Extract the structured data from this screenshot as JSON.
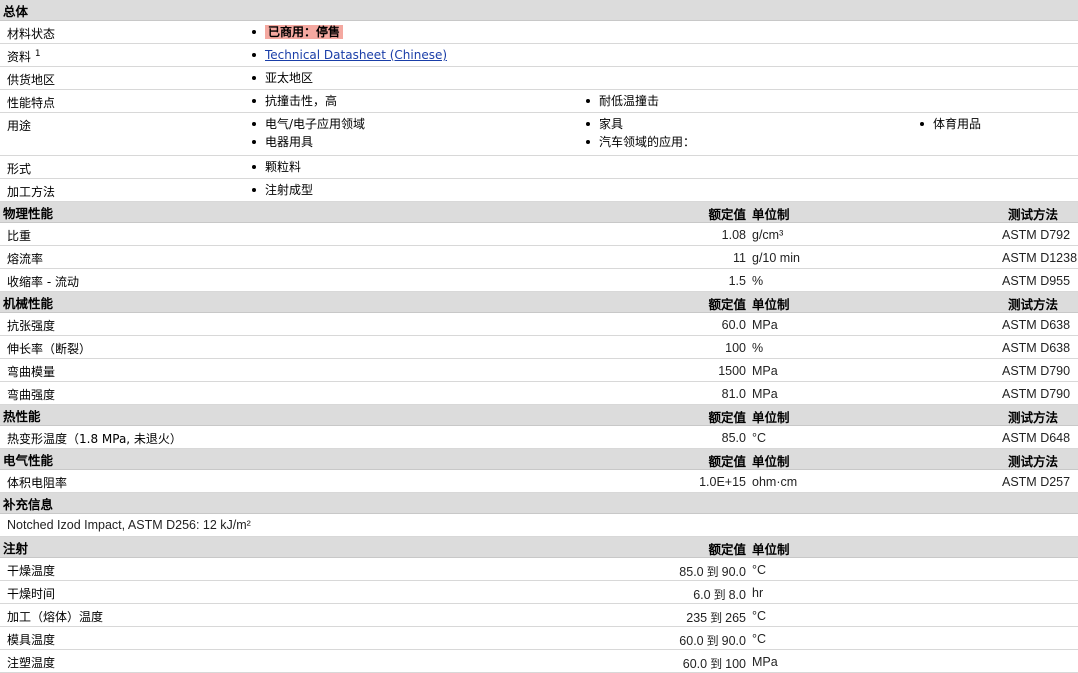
{
  "general": {
    "title": "总体",
    "status_label": "材料状态",
    "status_value": "已商用：停售",
    "docs_label": "资料",
    "docs_sup": "1",
    "docs_link": "Technical Datasheet (Chinese)",
    "region_label": "供货地区",
    "region_value": "亚太地区",
    "features_label": "性能特点",
    "features": [
      "抗撞击性，高",
      "耐低温撞击"
    ],
    "uses_label": "用途",
    "uses": [
      "电气/电子应用领域",
      "家具",
      "体育用品",
      "电器用具",
      "汽车领域的应用："
    ],
    "form_label": "形式",
    "form_value": "颗粒料",
    "process_label": "加工方法",
    "process_value": "注射成型"
  },
  "headers": {
    "nominal": "额定值",
    "unit": "单位制",
    "method": "测试方法"
  },
  "physical": {
    "title": "物理性能",
    "rows": [
      {
        "label": "比重",
        "value": "1.08",
        "unit": "g/cm³",
        "method": "ASTM D792"
      },
      {
        "label": "熔流率",
        "value": "11",
        "unit": "g/10 min",
        "method": "ASTM D1238"
      },
      {
        "label": "收缩率 - 流动",
        "value": "1.5",
        "unit": "%",
        "method": "ASTM D955"
      }
    ]
  },
  "mechanical": {
    "title": "机械性能",
    "rows": [
      {
        "label": "抗张强度",
        "value": "60.0",
        "unit": "MPa",
        "method": "ASTM D638"
      },
      {
        "label": "伸长率（断裂）",
        "value": "100",
        "unit": "%",
        "method": "ASTM D638"
      },
      {
        "label": "弯曲模量",
        "value": "1500",
        "unit": "MPa",
        "method": "ASTM D790"
      },
      {
        "label": "弯曲强度",
        "value": "81.0",
        "unit": "MPa",
        "method": "ASTM D790"
      }
    ]
  },
  "thermal": {
    "title": "热性能",
    "rows": [
      {
        "label": "热变形温度（1.8 MPa, 未退火）",
        "value": "85.0",
        "unit": "°C",
        "method": "ASTM D648"
      }
    ]
  },
  "electrical": {
    "title": "电气性能",
    "rows": [
      {
        "label": "体积电阻率",
        "value": "1.0E+15",
        "unit": "ohm·cm",
        "method": "ASTM D257"
      }
    ]
  },
  "supplement": {
    "title": "补充信息",
    "note": "Notched Izod Impact, ASTM D256: 12 kJ/m²"
  },
  "injection": {
    "title": "注射",
    "rows": [
      {
        "label": "干燥温度",
        "from": "85.0",
        "to": "90.0",
        "unit": "°C"
      },
      {
        "label": "干燥时间",
        "from": "6.0",
        "to": "8.0",
        "unit": "hr"
      },
      {
        "label": "加工（熔体）温度",
        "from": "235",
        "to": "265",
        "unit": "°C"
      },
      {
        "label": "模具温度",
        "from": "60.0",
        "to": "90.0",
        "unit": "°C"
      },
      {
        "label": "注塑温度",
        "from": "60.0",
        "to": "100",
        "unit": "MPa"
      }
    ],
    "range_word": "到"
  }
}
